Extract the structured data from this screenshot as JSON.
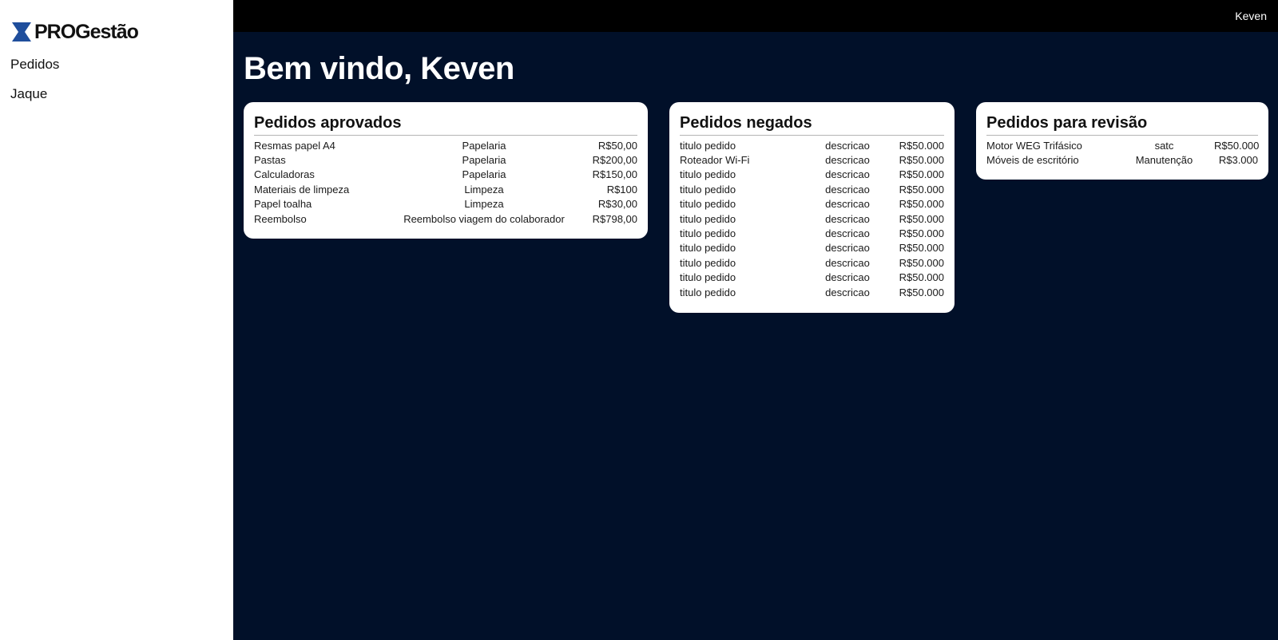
{
  "brand": {
    "logo_text": "PROGestão",
    "accent_color": "#1f4e9c"
  },
  "sidebar": {
    "items": [
      {
        "label": "Pedidos"
      },
      {
        "label": "Jaque"
      }
    ]
  },
  "topbar": {
    "user_name": "Keven"
  },
  "main": {
    "welcome": "Bem vindo, Keven"
  },
  "cards": {
    "aprovados": {
      "title": "Pedidos aprovados",
      "rows": [
        [
          "Resmas papel A4",
          "Papelaria",
          "R$50,00"
        ],
        [
          "Pastas",
          "Papelaria",
          "R$200,00"
        ],
        [
          "Calculadoras",
          "Papelaria",
          "R$150,00"
        ],
        [
          "Materiais de limpeza",
          "Limpeza",
          "R$100"
        ],
        [
          "Papel toalha",
          "Limpeza",
          "R$30,00"
        ],
        [
          "Reembolso",
          "Reembolso viagem do colaborador",
          "R$798,00"
        ]
      ]
    },
    "negados": {
      "title": "Pedidos negados",
      "rows": [
        [
          "titulo pedido",
          "descricao",
          "R$50.000"
        ],
        [
          "Roteador Wi-Fi",
          "descricao",
          "R$50.000"
        ],
        [
          "titulo pedido",
          "descricao",
          "R$50.000"
        ],
        [
          "titulo pedido",
          "descricao",
          "R$50.000"
        ],
        [
          "titulo pedido",
          "descricao",
          "R$50.000"
        ],
        [
          "titulo pedido",
          "descricao",
          "R$50.000"
        ],
        [
          "titulo pedido",
          "descricao",
          "R$50.000"
        ],
        [
          "titulo pedido",
          "descricao",
          "R$50.000"
        ],
        [
          "titulo pedido",
          "descricao",
          "R$50.000"
        ],
        [
          "titulo pedido",
          "descricao",
          "R$50.000"
        ],
        [
          "titulo pedido",
          "descricao",
          "R$50.000"
        ]
      ]
    },
    "revisao": {
      "title": "Pedidos para revisão",
      "rows": [
        [
          "Motor WEG Trifásico",
          "satc",
          "R$50.000"
        ],
        [
          "Móveis de escritório",
          "Manutenção",
          "R$3.000"
        ]
      ]
    }
  }
}
